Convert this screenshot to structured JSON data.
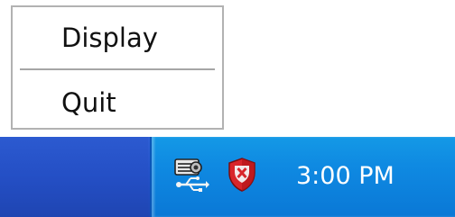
{
  "context_menu": {
    "items": [
      {
        "label": "Display"
      },
      {
        "label": "Quit"
      }
    ]
  },
  "taskbar": {
    "tray": {
      "icons": [
        "usb-device-icon",
        "security-alert-shield-icon"
      ],
      "clock": "3:00 PM"
    }
  },
  "colors": {
    "taskbar": "#245DDA",
    "tray": "#0F8AE2",
    "menu_border": "#B2B2B2"
  }
}
